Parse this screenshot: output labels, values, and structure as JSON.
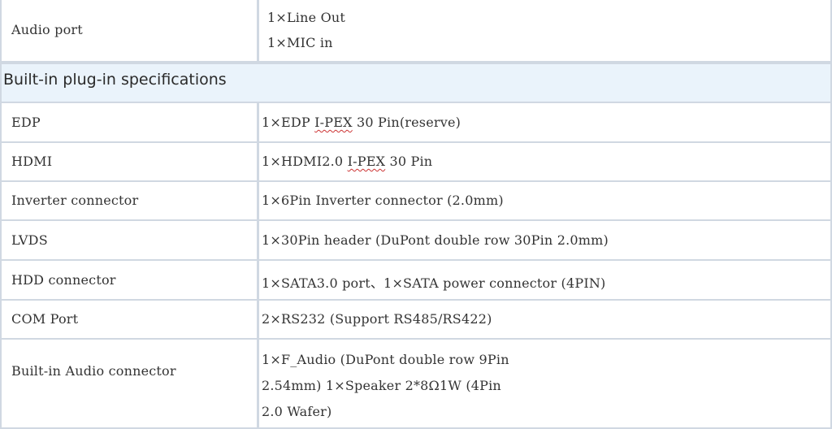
{
  "rows_top": {
    "audio_port": {
      "label": "Audio port",
      "lines": [
        "1×Line Out",
        "1×MIC in"
      ]
    }
  },
  "section": {
    "title": "Built-in plug-in specifications"
  },
  "rows": [
    {
      "label": "EDP",
      "pre": "1×EDP ",
      "mark": "I-PEX",
      "post": " 30 Pin(reserve)"
    },
    {
      "label": "HDMI",
      "pre": "1×HDMI2.0 ",
      "mark": "I-PEX",
      "post": " 30 Pin"
    },
    {
      "label": "Inverter connector",
      "pre": "1×6Pin Inverter connector (2.0mm)",
      "mark": "",
      "post": ""
    },
    {
      "label": "LVDS",
      "pre": "1×30Pin header (DuPont double row 30Pin 2.0mm)",
      "mark": "",
      "post": ""
    },
    {
      "label": "HDD connector",
      "pre": "1×SATA3.0 port、1×SATA power connector  (4PIN)",
      "mark": "",
      "post": ""
    },
    {
      "label": "COM Port",
      "pre": "2×RS232  (Support RS485/RS422)",
      "mark": "",
      "post": ""
    }
  ],
  "audio_connector": {
    "label": "Built-in Audio connector",
    "lines": [
      "1×F_Audio  (DuPont double row 9Pin",
      "2.54mm)  1×Speaker 2*8Ω1W  (4Pin",
      "2.0 Wafer)"
    ]
  }
}
